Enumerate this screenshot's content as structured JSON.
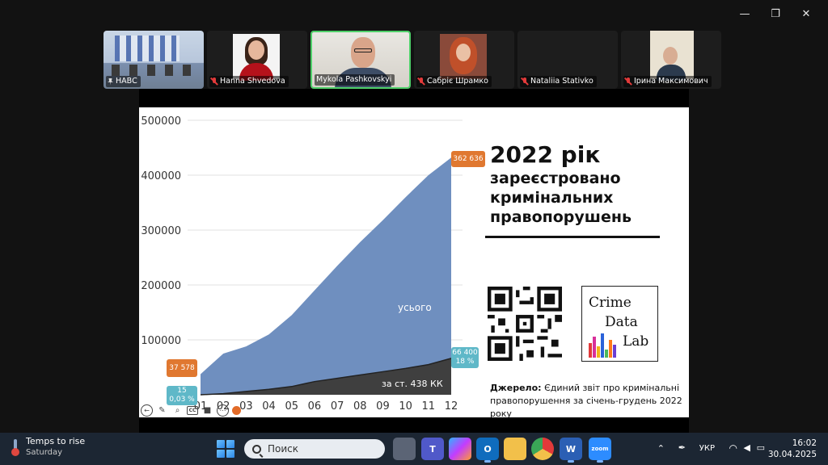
{
  "window_controls": {
    "minimize": "—",
    "restore": "❐",
    "close": "✕"
  },
  "participants": [
    {
      "name": "НАВС",
      "pinned": true,
      "muted": false,
      "active": false,
      "video": "room"
    },
    {
      "name": "Hanna Shvedova",
      "pinned": false,
      "muted": true,
      "active": false,
      "video": "woman-red"
    },
    {
      "name": "Mykola Pashkovskyi",
      "pinned": false,
      "muted": false,
      "active": true,
      "video": "man"
    },
    {
      "name": "Сабріє Шрамко",
      "pinned": false,
      "muted": true,
      "active": false,
      "video": "woman-redhair"
    },
    {
      "name": "Nataliia Stativko",
      "pinned": false,
      "muted": true,
      "active": false,
      "video": "off"
    },
    {
      "name": "Ірина Максимович",
      "pinned": false,
      "muted": true,
      "active": false,
      "video": "office"
    }
  ],
  "slide": {
    "title": "2022 рік",
    "subtitle": "зареєстровано кримінальних правопорушень",
    "area_label_total": "усього",
    "area_label_sub": "за ст. 438 КК",
    "callouts": {
      "total_end": "362 636",
      "total_start": "37 578",
      "sub_end_value": "66 400",
      "sub_end_pct": "18 %",
      "sub_start_value": "15",
      "sub_start_pct": "0,03 %"
    },
    "logo": {
      "l1": "Crime",
      "l2": "Data",
      "l3": "Lab"
    },
    "source_label": "Джерело:",
    "source_text": "Єдиний звіт про кримінальні правопорушення за січень-грудень 2022 року"
  },
  "chart_data": {
    "type": "area",
    "categories": [
      "01",
      "02",
      "03",
      "04",
      "05",
      "06",
      "07",
      "08",
      "09",
      "10",
      "11",
      "12"
    ],
    "ylim": [
      0,
      500000
    ],
    "yticks": [
      "500000",
      "400000",
      "300000",
      "200000",
      "100000"
    ],
    "series": [
      {
        "name": "усього",
        "color": "#6f8fbf",
        "values": [
          37578,
          75000,
          88000,
          110000,
          145000,
          190000,
          235000,
          278000,
          318000,
          360000,
          400000,
          432000
        ]
      },
      {
        "name": "за ст. 438 КК",
        "color": "#3f3f3f",
        "values": [
          15,
          2000,
          6000,
          10000,
          15000,
          24000,
          30000,
          36000,
          42000,
          48000,
          55000,
          66400
        ]
      }
    ]
  },
  "slide_toolbar": [
    "back-icon",
    "pen-icon",
    "zoom-icon",
    "cc-icon",
    "video-icon",
    "more-icon",
    "record-icon"
  ],
  "taskbar": {
    "weather_title": "Temps to rise",
    "weather_sub": "Saturday",
    "search_placeholder": "Поиск",
    "lang": "УКР",
    "time": "16:02",
    "date": "30.04.2025"
  }
}
